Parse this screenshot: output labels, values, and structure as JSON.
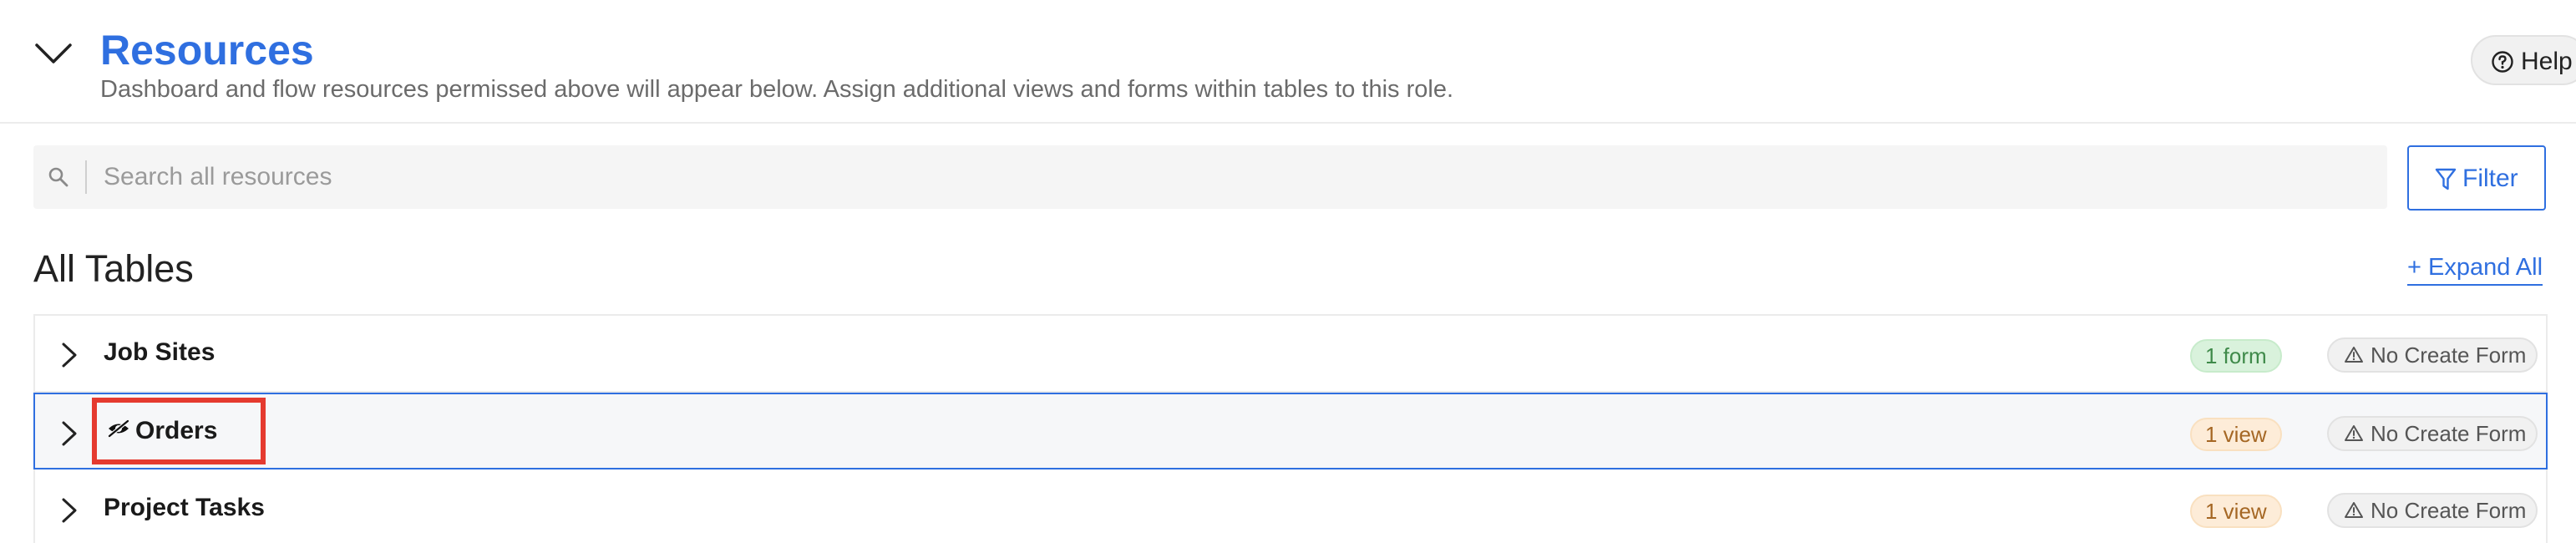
{
  "header": {
    "title": "Resources",
    "subtitle": "Dashboard and flow resources permissed above will appear below. Assign additional views and forms within tables to this role.",
    "help_label": "Help"
  },
  "search": {
    "placeholder": "Search all resources",
    "value": ""
  },
  "filter_label": "Filter",
  "section": {
    "title": "All Tables",
    "expand_all_label": "+ Expand All"
  },
  "rows": [
    {
      "name": "Job Sites",
      "badge": "1 form",
      "badge_color": "green",
      "status": "No Create Form",
      "selected": false
    },
    {
      "name": "Orders",
      "badge": "1 view",
      "badge_color": "orange",
      "status": "No Create Form",
      "selected": true,
      "icon": "eye-slash-icon"
    },
    {
      "name": "Project Tasks",
      "badge": "1 view",
      "badge_color": "orange",
      "status": "No Create Form",
      "selected": false
    }
  ],
  "colors": {
    "accent": "#2f6fe0",
    "highlight_box": "#e53a2f",
    "badge_green_bg": "#d9f2dc",
    "badge_orange_bg": "#fdecd8"
  }
}
